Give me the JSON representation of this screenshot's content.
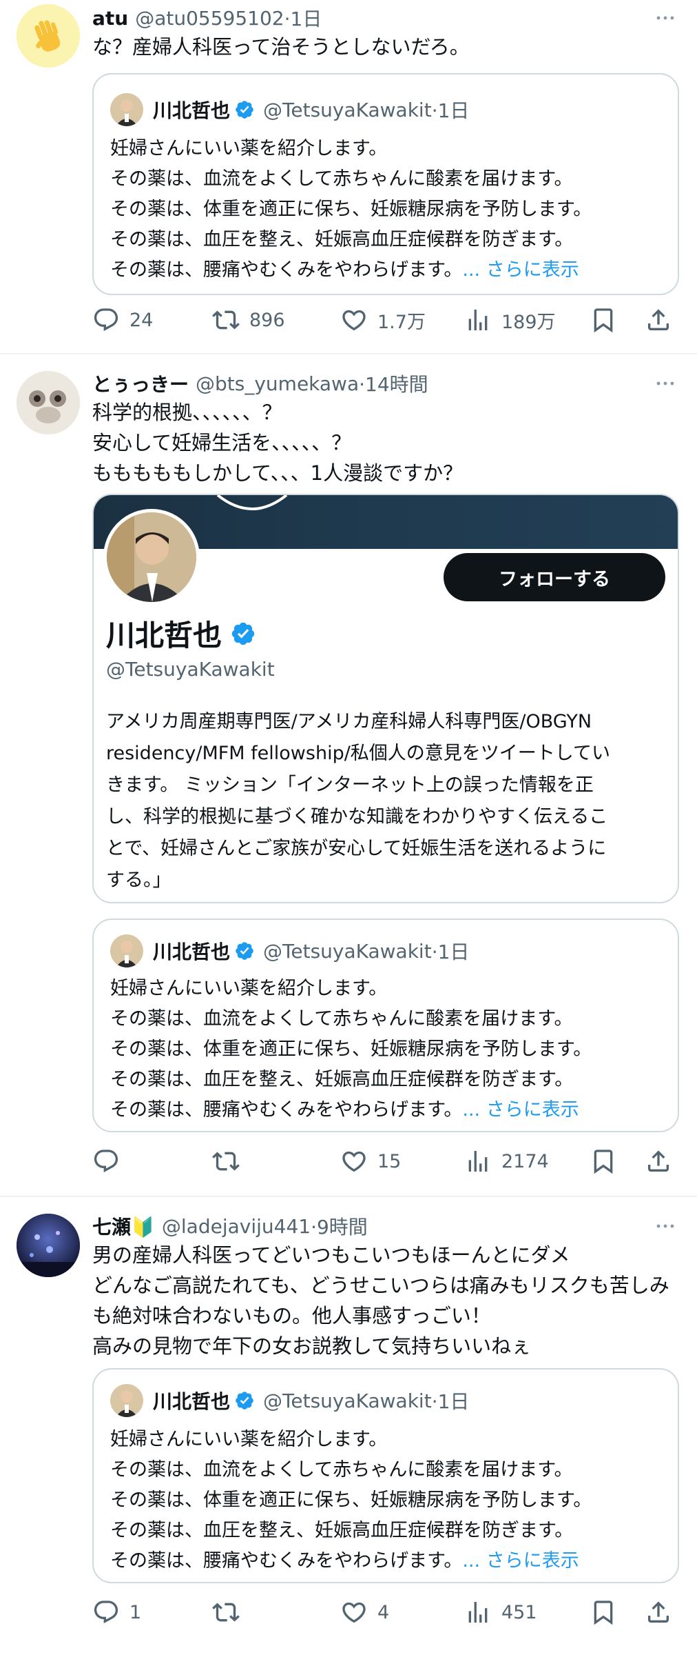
{
  "tweets": [
    {
      "author": "atu",
      "handle": "@atu05595102",
      "time": "·1日",
      "text": "な？産婦人科医って治そうとしないだろ。",
      "quote": {
        "author": "川北哲也",
        "handle": "@TetsuyaKawakit",
        "time": "·1日",
        "text": "妊婦さんにいい薬を紹介します。\nその薬は、血流をよくして赤ちゃんに酸素を届けます。\nその薬は、体重を適正に保ち、妊娠糖尿病を予防します。\nその薬は、血圧を整え、妊娠高血圧症候群を防ぎます。\nその薬は、腰痛やむくみをやわらげます。",
        "more": "... さらに表示"
      },
      "stats": {
        "replies": "24",
        "retweets": "896",
        "likes": "1.7万",
        "views": "189万"
      }
    },
    {
      "author": "とぅっきー",
      "handle": "@bts_yumekawa",
      "time": "·14時間",
      "text": "科学的根拠、、、、、、？\n安心して妊婦生活を、、、、、？\nもももももしかして、、、1人漫談ですか？",
      "profile": {
        "name": "川北哲也",
        "handle": "@TetsuyaKawakit",
        "follow": "フォローする",
        "bio": "アメリカ周産期専門医/アメリカ産科婦人科専門医/OBGYN\nresidency/MFM fellowship/私個人の意見をツイートしてい\nきます。 ミッション「インターネット上の誤った情報を正\nし、科学的根拠に基づく確かな知識をわかりやすく伝えるこ\nとで、妊婦さんとご家族が安心して妊娠生活を送れるように\nする。」"
      },
      "quote": {
        "author": "川北哲也",
        "handle": "@TetsuyaKawakit",
        "time": "·1日",
        "text": "妊婦さんにいい薬を紹介します。\nその薬は、血流をよくして赤ちゃんに酸素を届けます。\nその薬は、体重を適正に保ち、妊娠糖尿病を予防します。\nその薬は、血圧を整え、妊娠高血圧症候群を防ぎます。\nその薬は、腰痛やむくみをやわらげます。",
        "more": "... さらに表示"
      },
      "stats": {
        "replies": "",
        "retweets": "",
        "likes": "15",
        "views": "2174"
      }
    },
    {
      "author": "七瀬🔰",
      "handle": "@ladejaviju441",
      "time": "·9時間",
      "text": "男の産婦人科医ってどいつもこいつもほーんとにダメ\nどんなご高説たれても、どうせこいつらは痛みもリスクも苦しみ\nも絶対味合わないもの。他人事感すっごい！\n高みの見物で年下の女お説教して気持ちいいねぇ",
      "quote": {
        "author": "川北哲也",
        "handle": "@TetsuyaKawakit",
        "time": "·1日",
        "text": "妊婦さんにいい薬を紹介します。\nその薬は、血流をよくして赤ちゃんに酸素を届けます。\nその薬は、体重を適正に保ち、妊娠糖尿病を予防します。\nその薬は、血圧を整え、妊娠高血圧症候群を防ぎます。\nその薬は、腰痛やむくみをやわらげます。",
        "more": "... さらに表示"
      },
      "stats": {
        "replies": "1",
        "retweets": "",
        "likes": "4",
        "views": "451"
      }
    }
  ],
  "colors": {
    "accent": "#1d9bf0",
    "text": "#0f1419",
    "muted": "#536471",
    "border": "#cfd9de"
  },
  "icons": [
    "more-icon",
    "reply-icon",
    "retweet-icon",
    "like-icon",
    "views-icon",
    "bookmark-icon",
    "share-icon",
    "verified-icon"
  ]
}
